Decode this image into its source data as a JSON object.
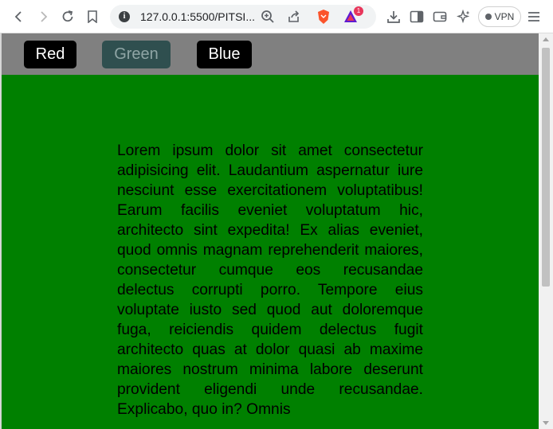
{
  "browser": {
    "url": "127.0.0.1:5500/PITSI...",
    "vpn_label": "VPN",
    "rewards_badge": "1",
    "icons": [
      "back-icon",
      "forward-icon",
      "reload-icon",
      "bookmark-icon",
      "info-icon",
      "zoom-icon",
      "share-icon",
      "brave-shields-icon",
      "brave-rewards-icon",
      "download-icon",
      "sidebar-icon",
      "wallet-icon",
      "leo-ai-icon",
      "vpn-icon",
      "menu-icon"
    ]
  },
  "page": {
    "background": "#008000",
    "navbar_color": "#808080",
    "buttons": [
      {
        "label": "Red",
        "bg": "#000000",
        "fg": "#ffffff"
      },
      {
        "label": "Green",
        "bg": "#2f4f4f",
        "fg": "#8fa5a5"
      },
      {
        "label": "Blue",
        "bg": "#000000",
        "fg": "#ffffff"
      }
    ],
    "paragraph": "Lorem ipsum dolor sit amet consectetur adipisicing elit. Laudantium aspernatur iure nesciunt esse exercitationem voluptatibus! Earum facilis eveniet voluptatum hic, architecto sint expedita! Ex alias eveniet, quod omnis magnam reprehenderit maiores, consectetur cumque eos recusandae delectus corrupti porro. Tempore eius voluptate iusto sed quod aut doloremque fuga, reiciendis quidem delectus fugit architecto quas at dolor quasi ab maxime maiores nostrum minima labore deserunt provident eligendi unde recusandae. Explicabo, quo in? Omnis"
  }
}
